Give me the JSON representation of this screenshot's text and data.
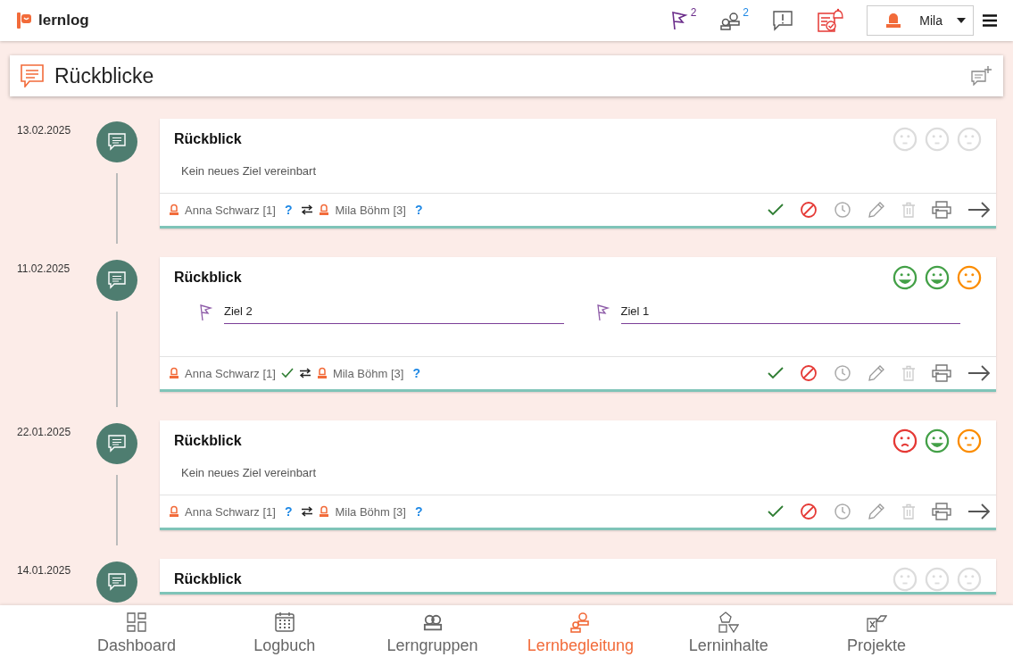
{
  "app": {
    "name": "lernlog"
  },
  "header": {
    "flag_count": "2",
    "people_count": "2",
    "user": {
      "name": "Mila"
    }
  },
  "page": {
    "title": "Rückblicke"
  },
  "entries": [
    {
      "date": "13.02.2025",
      "title": "Rückblick",
      "moods": [
        {
          "kind": "unset"
        },
        {
          "kind": "unset"
        },
        {
          "kind": "unset"
        }
      ],
      "note": "Kein neues Ziel vereinbart",
      "persons": [
        {
          "name": "Anna Schwarz [1]",
          "status": {
            "kind": "question",
            "text": "?"
          }
        },
        {
          "name": "Mila Böhm [3]",
          "status": {
            "kind": "question",
            "text": "?"
          }
        }
      ]
    },
    {
      "date": "11.02.2025",
      "title": "Rückblick",
      "moods": [
        {
          "kind": "happy"
        },
        {
          "kind": "happy"
        },
        {
          "kind": "neutral"
        }
      ],
      "goals": [
        {
          "label": "Ziel 2"
        },
        {
          "label": "Ziel 1"
        }
      ],
      "persons": [
        {
          "name": "Anna Schwarz [1]",
          "status": {
            "kind": "check"
          }
        },
        {
          "name": "Mila Böhm [3]",
          "status": {
            "kind": "question",
            "text": "?"
          }
        }
      ]
    },
    {
      "date": "22.01.2025",
      "title": "Rückblick",
      "moods": [
        {
          "kind": "sad"
        },
        {
          "kind": "happy"
        },
        {
          "kind": "neutral"
        }
      ],
      "note": "Kein neues Ziel vereinbart",
      "persons": [
        {
          "name": "Anna Schwarz [1]",
          "status": {
            "kind": "question",
            "text": "?"
          }
        },
        {
          "name": "Mila Böhm [3]",
          "status": {
            "kind": "question",
            "text": "?"
          }
        }
      ]
    },
    {
      "date": "14.01.2025",
      "title": "Rückblick",
      "moods": [
        {
          "kind": "unset"
        },
        {
          "kind": "unset"
        },
        {
          "kind": "unset"
        }
      ]
    }
  ],
  "nav": [
    {
      "label": "Dashboard",
      "selected": false
    },
    {
      "label": "Logbuch",
      "selected": false
    },
    {
      "label": "Lerngruppen",
      "selected": false
    },
    {
      "label": "Lernbegleitung",
      "selected": true
    },
    {
      "label": "Lerninhalte",
      "selected": false
    },
    {
      "label": "Projekte",
      "selected": false
    }
  ]
}
